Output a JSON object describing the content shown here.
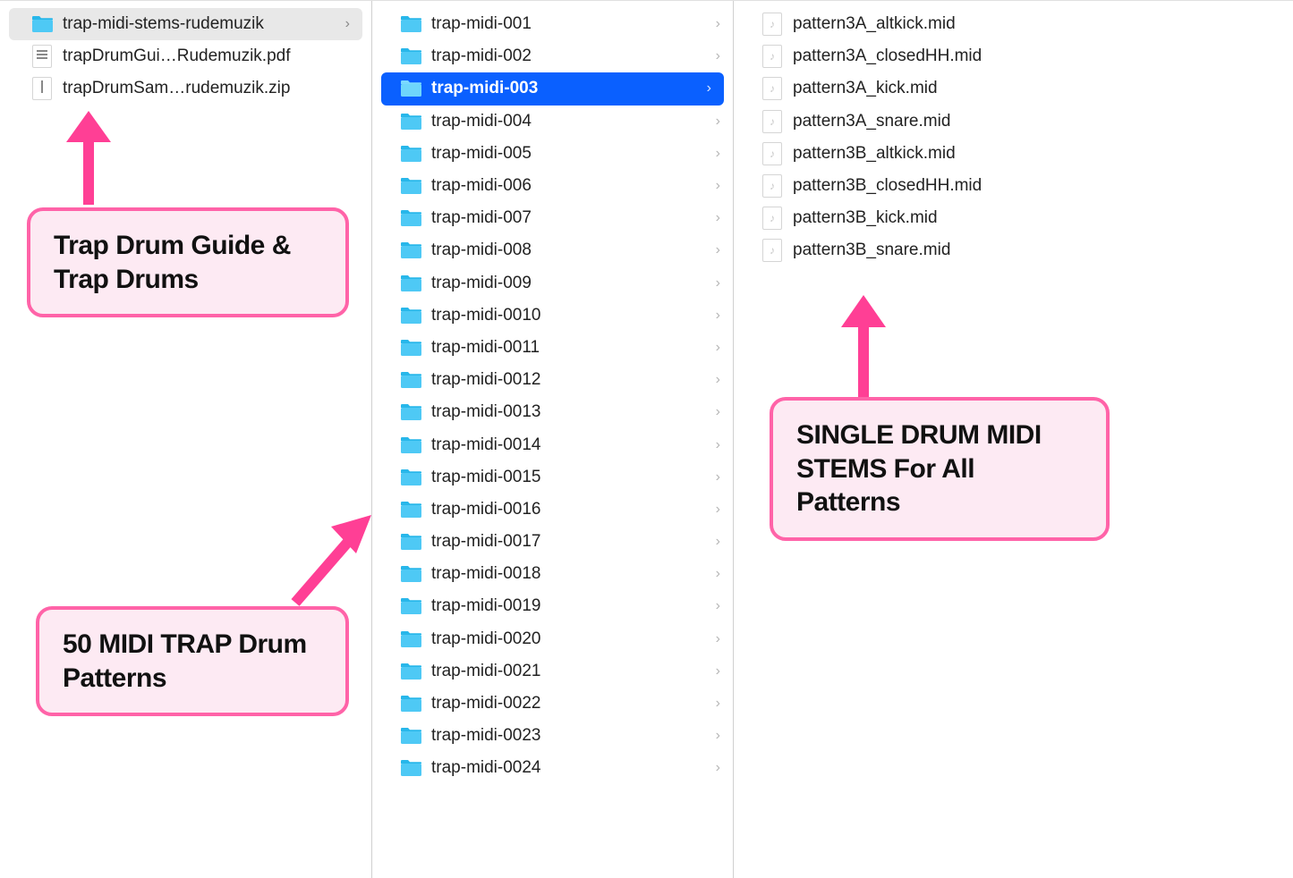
{
  "col1": {
    "items": [
      {
        "type": "folder",
        "label": "trap-midi-stems-rudemuzik",
        "selected": "gray",
        "hasChevron": true
      },
      {
        "type": "pdf",
        "label": "trapDrumGui…Rudemuzik.pdf",
        "selected": "",
        "hasChevron": false
      },
      {
        "type": "zip",
        "label": "trapDrumSam…rudemuzik.zip",
        "selected": "",
        "hasChevron": false
      }
    ]
  },
  "col2": {
    "items": [
      {
        "type": "folder",
        "label": "trap-midi-001",
        "selected": "",
        "hasChevron": true
      },
      {
        "type": "folder",
        "label": "trap-midi-002",
        "selected": "",
        "hasChevron": true
      },
      {
        "type": "folder",
        "label": "trap-midi-003",
        "selected": "blue",
        "hasChevron": true
      },
      {
        "type": "folder",
        "label": "trap-midi-004",
        "selected": "",
        "hasChevron": true
      },
      {
        "type": "folder",
        "label": "trap-midi-005",
        "selected": "",
        "hasChevron": true
      },
      {
        "type": "folder",
        "label": "trap-midi-006",
        "selected": "",
        "hasChevron": true
      },
      {
        "type": "folder",
        "label": "trap-midi-007",
        "selected": "",
        "hasChevron": true
      },
      {
        "type": "folder",
        "label": "trap-midi-008",
        "selected": "",
        "hasChevron": true
      },
      {
        "type": "folder",
        "label": "trap-midi-009",
        "selected": "",
        "hasChevron": true
      },
      {
        "type": "folder",
        "label": "trap-midi-0010",
        "selected": "",
        "hasChevron": true
      },
      {
        "type": "folder",
        "label": "trap-midi-0011",
        "selected": "",
        "hasChevron": true
      },
      {
        "type": "folder",
        "label": "trap-midi-0012",
        "selected": "",
        "hasChevron": true
      },
      {
        "type": "folder",
        "label": "trap-midi-0013",
        "selected": "",
        "hasChevron": true
      },
      {
        "type": "folder",
        "label": "trap-midi-0014",
        "selected": "",
        "hasChevron": true
      },
      {
        "type": "folder",
        "label": "trap-midi-0015",
        "selected": "",
        "hasChevron": true
      },
      {
        "type": "folder",
        "label": "trap-midi-0016",
        "selected": "",
        "hasChevron": true
      },
      {
        "type": "folder",
        "label": "trap-midi-0017",
        "selected": "",
        "hasChevron": true
      },
      {
        "type": "folder",
        "label": "trap-midi-0018",
        "selected": "",
        "hasChevron": true
      },
      {
        "type": "folder",
        "label": "trap-midi-0019",
        "selected": "",
        "hasChevron": true
      },
      {
        "type": "folder",
        "label": "trap-midi-0020",
        "selected": "",
        "hasChevron": true
      },
      {
        "type": "folder",
        "label": "trap-midi-0021",
        "selected": "",
        "hasChevron": true
      },
      {
        "type": "folder",
        "label": "trap-midi-0022",
        "selected": "",
        "hasChevron": true
      },
      {
        "type": "folder",
        "label": "trap-midi-0023",
        "selected": "",
        "hasChevron": true
      },
      {
        "type": "folder",
        "label": "trap-midi-0024",
        "selected": "",
        "hasChevron": true
      }
    ]
  },
  "col3": {
    "items": [
      {
        "type": "mid",
        "label": "pattern3A_altkick.mid",
        "selected": "",
        "hasChevron": false
      },
      {
        "type": "mid",
        "label": "pattern3A_closedHH.mid",
        "selected": "",
        "hasChevron": false
      },
      {
        "type": "mid",
        "label": "pattern3A_kick.mid",
        "selected": "",
        "hasChevron": false
      },
      {
        "type": "mid",
        "label": "pattern3A_snare.mid",
        "selected": "",
        "hasChevron": false
      },
      {
        "type": "mid",
        "label": "pattern3B_altkick.mid",
        "selected": "",
        "hasChevron": false
      },
      {
        "type": "mid",
        "label": "pattern3B_closedHH.mid",
        "selected": "",
        "hasChevron": false
      },
      {
        "type": "mid",
        "label": "pattern3B_kick.mid",
        "selected": "",
        "hasChevron": false
      },
      {
        "type": "mid",
        "label": "pattern3B_snare.mid",
        "selected": "",
        "hasChevron": false
      }
    ]
  },
  "annotations": {
    "callout1": "Trap Drum Guide & Trap Drums",
    "callout2": "50 MIDI TRAP Drum Patterns",
    "callout3": "SINGLE DRUM MIDI STEMS For All Patterns"
  },
  "colors": {
    "folder": "#4ec9f5",
    "folderDark": "#28b7ea",
    "selectedBlue": "#0a60ff",
    "selectedGray": "#e8e8e8",
    "annotationPink": "#ff63a8",
    "annotationFill": "#fdeaf3",
    "arrowPink": "#ff3f95"
  }
}
